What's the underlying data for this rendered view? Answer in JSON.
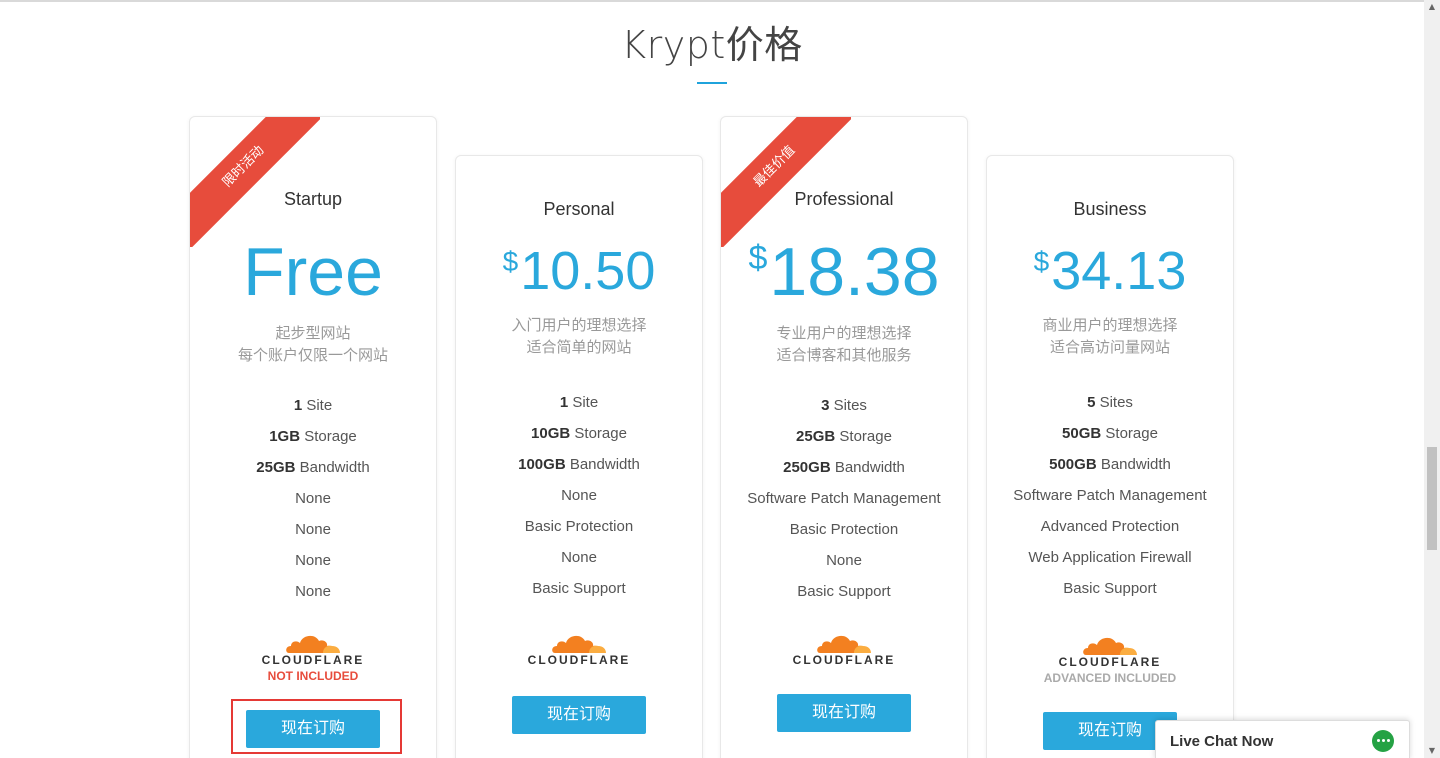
{
  "page": {
    "title": "Krypt价格"
  },
  "plans": [
    {
      "ribbon": "限时活动",
      "name": "Startup",
      "currency": "",
      "price": "Free",
      "desc_line1": "起步型网站",
      "desc_line2": "每个账户仅限一个网站",
      "features": [
        {
          "bold": "1",
          "text": " Site"
        },
        {
          "bold": "1GB",
          "text": " Storage"
        },
        {
          "bold": "25GB",
          "text": " Bandwidth"
        },
        {
          "bold": "",
          "text": "None"
        },
        {
          "bold": "",
          "text": "None"
        },
        {
          "bold": "",
          "text": "None"
        },
        {
          "bold": "",
          "text": "None"
        }
      ],
      "cloudflare_word": "CLOUDFLARE",
      "cloudflare_note": "NOT INCLUDED",
      "button": "现在订购"
    },
    {
      "ribbon": "",
      "name": "Personal",
      "currency": "$",
      "price": "10.50",
      "desc_line1": "入门用户的理想选择",
      "desc_line2": "适合简单的网站",
      "features": [
        {
          "bold": "1",
          "text": " Site"
        },
        {
          "bold": "10GB",
          "text": " Storage"
        },
        {
          "bold": "100GB",
          "text": " Bandwidth"
        },
        {
          "bold": "",
          "text": "None"
        },
        {
          "bold": "",
          "text": "Basic Protection"
        },
        {
          "bold": "",
          "text": "None"
        },
        {
          "bold": "",
          "text": "Basic Support"
        }
      ],
      "cloudflare_word": "CLOUDFLARE",
      "cloudflare_note": "",
      "button": "现在订购"
    },
    {
      "ribbon": "最佳价值",
      "name": "Professional",
      "currency": "$",
      "price": "18.38",
      "desc_line1": "专业用户的理想选择",
      "desc_line2": "适合博客和其他服务",
      "features": [
        {
          "bold": "3",
          "text": " Sites"
        },
        {
          "bold": "25GB",
          "text": " Storage"
        },
        {
          "bold": "250GB",
          "text": " Bandwidth"
        },
        {
          "bold": "",
          "text": "Software Patch Management"
        },
        {
          "bold": "",
          "text": "Basic Protection"
        },
        {
          "bold": "",
          "text": "None"
        },
        {
          "bold": "",
          "text": "Basic Support"
        }
      ],
      "cloudflare_word": "CLOUDFLARE",
      "cloudflare_note": "",
      "button": "现在订购"
    },
    {
      "ribbon": "",
      "name": "Business",
      "currency": "$",
      "price": "34.13",
      "desc_line1": "商业用户的理想选择",
      "desc_line2": "适合高访问量网站",
      "features": [
        {
          "bold": "5",
          "text": " Sites"
        },
        {
          "bold": "50GB",
          "text": " Storage"
        },
        {
          "bold": "500GB",
          "text": " Bandwidth"
        },
        {
          "bold": "",
          "text": "Software Patch Management"
        },
        {
          "bold": "",
          "text": "Advanced Protection"
        },
        {
          "bold": "",
          "text": "Web Application Firewall"
        },
        {
          "bold": "",
          "text": "Basic Support"
        }
      ],
      "cloudflare_word": "CLOUDFLARE",
      "cloudflare_note": "ADVANCED INCLUDED",
      "button": "现在订购"
    }
  ],
  "live_chat": {
    "label": "Live Chat Now",
    "icon": "chat-bubble-icon"
  },
  "colors": {
    "accent": "#2aa8dc",
    "ribbon": "#e74c3c",
    "not_included": "#e74c3c",
    "advanced_included": "#aaaaaa",
    "cloudflare_orange": "#f38020",
    "chat_green": "#25a244"
  }
}
